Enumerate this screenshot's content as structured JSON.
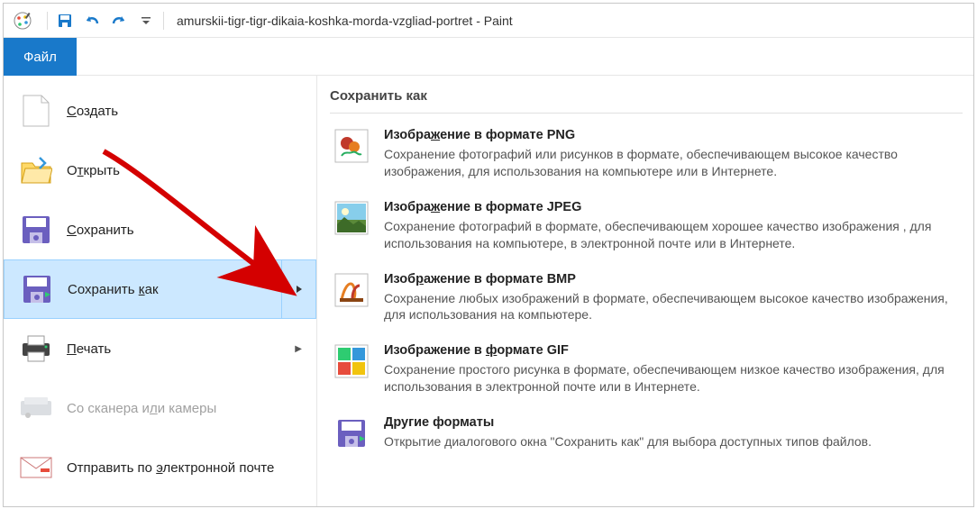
{
  "title": "amurskii-tigr-tigr-dikaia-koshka-morda-vzgliad-portret - Paint",
  "tab_file": "Файл",
  "left_menu": {
    "create": "Создать",
    "open": "Открыть",
    "save": "Сохранить",
    "save_as": "Сохранить как",
    "print": "Печать",
    "from_scanner": "Со сканера или камеры",
    "send_email": "Отправить по электронной почте"
  },
  "panel_title": "Сохранить как",
  "formats": {
    "png": {
      "title": "Изображение в формате PNG",
      "desc": "Сохранение фотографий или рисунков в формате, обеспечивающем высокое качество изображения, для использования на компьютере или в Интернете."
    },
    "jpeg": {
      "title": "Изображение в формате JPEG",
      "desc": "Сохранение фотографий в формате, обеспечивающем хорошее качество изображения , для использования на компьютере, в электронной почте или в Интернете."
    },
    "bmp": {
      "title": "Изображение в формате BMP",
      "desc": "Сохранение любых изображений в формате, обеспечивающем высокое качество изображения, для использования на компьютере."
    },
    "gif": {
      "title": "Изображение в формате GIF",
      "desc": "Сохранение простого рисунка в формате, обеспечивающем низкое качество изображения, для использования в электронной почте или в Интернете."
    },
    "other": {
      "title": "Другие форматы",
      "desc": "Открытие диалогового окна \"Сохранить как\" для выбора доступных типов файлов."
    }
  }
}
